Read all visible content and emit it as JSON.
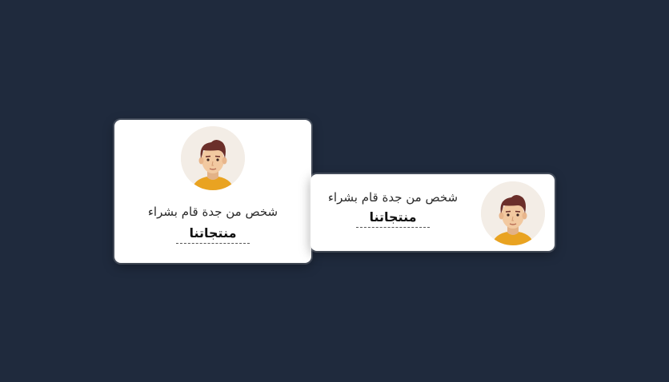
{
  "notifications": [
    {
      "message": "شخص من جدة قام بشراء",
      "emphasis": "منتجاتنا",
      "avatar_icon": "male-avatar-icon"
    },
    {
      "message": "شخص من جدة قام بشراء",
      "emphasis": "منتجاتنا",
      "avatar_icon": "male-avatar-icon"
    }
  ],
  "colors": {
    "background": "#1f2a3d",
    "card": "#ffffff",
    "avatar_bg": "#f3ede6",
    "hair": "#6b2f2a",
    "skin": "#f2c9a0",
    "shirt": "#e9a321"
  }
}
